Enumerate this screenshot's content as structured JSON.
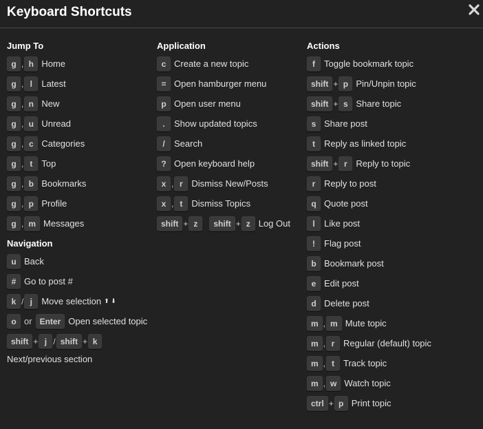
{
  "modal": {
    "title": "Keyboard Shortcuts",
    "close_icon": "close-x-icon"
  },
  "jump_to": {
    "title": "Jump To",
    "items": [
      {
        "keys": [
          "g",
          "h"
        ],
        "label": "Home"
      },
      {
        "keys": [
          "g",
          "l"
        ],
        "label": "Latest"
      },
      {
        "keys": [
          "g",
          "n"
        ],
        "label": "New"
      },
      {
        "keys": [
          "g",
          "u"
        ],
        "label": "Unread"
      },
      {
        "keys": [
          "g",
          "c"
        ],
        "label": "Categories"
      },
      {
        "keys": [
          "g",
          "t"
        ],
        "label": "Top"
      },
      {
        "keys": [
          "g",
          "b"
        ],
        "label": "Bookmarks"
      },
      {
        "keys": [
          "g",
          "p"
        ],
        "label": "Profile"
      },
      {
        "keys": [
          "g",
          "m"
        ],
        "label": "Messages"
      }
    ]
  },
  "navigation": {
    "title": "Navigation",
    "back": {
      "key": "u",
      "label": "Back"
    },
    "goto_post": {
      "key": "#",
      "label": "Go to post #"
    },
    "move_selection": {
      "key1": "k",
      "sep": "/",
      "key2": "j",
      "label": "Move selection",
      "arrows": "⬆ ⬇"
    },
    "open_selected": {
      "key1": "o",
      "or": "or",
      "key2": "Enter",
      "label": "Open selected topic"
    },
    "next_prev_section": {
      "k1": "shift",
      "plus1": "+",
      "k2": "j",
      "slash": "/",
      "k3": "shift",
      "plus2": "+",
      "k4": "k",
      "label": "Next/previous section"
    }
  },
  "application": {
    "title": "Application",
    "items": [
      {
        "keys": [
          "c"
        ],
        "label": "Create a new topic"
      },
      {
        "keys": [
          "="
        ],
        "label": "Open hamburger menu"
      },
      {
        "keys": [
          "p"
        ],
        "label": "Open user menu"
      },
      {
        "keys": [
          "."
        ],
        "label": "Show updated topics"
      },
      {
        "keys": [
          "/"
        ],
        "label": "Search"
      },
      {
        "keys": [
          "?"
        ],
        "label": "Open keyboard help"
      },
      {
        "keys": [
          "x",
          "r"
        ],
        "label": "Dismiss New/Posts"
      },
      {
        "keys": [
          "x",
          "t"
        ],
        "label": "Dismiss Topics"
      }
    ],
    "logout": {
      "k1": "shift",
      "plus1": "+",
      "k2": "z",
      "k3": "shift",
      "plus2": "+",
      "k4": "z",
      "label": "Log Out"
    }
  },
  "actions": {
    "title": "Actions",
    "items": [
      {
        "keys": [
          "f"
        ],
        "join": "",
        "label": "Toggle bookmark topic"
      },
      {
        "keys": [
          "shift",
          "p"
        ],
        "join": "+",
        "label": "Pin/Unpin topic"
      },
      {
        "keys": [
          "shift",
          "s"
        ],
        "join": "+",
        "label": "Share topic"
      },
      {
        "keys": [
          "s"
        ],
        "join": "",
        "label": "Share post"
      },
      {
        "keys": [
          "t"
        ],
        "join": "",
        "label": "Reply as linked topic"
      },
      {
        "keys": [
          "shift",
          "r"
        ],
        "join": "+",
        "label": "Reply to topic"
      },
      {
        "keys": [
          "r"
        ],
        "join": "",
        "label": "Reply to post"
      },
      {
        "keys": [
          "q"
        ],
        "join": "",
        "label": "Quote post"
      },
      {
        "keys": [
          "l"
        ],
        "join": "",
        "label": "Like post"
      },
      {
        "keys": [
          "!"
        ],
        "join": "",
        "label": "Flag post"
      },
      {
        "keys": [
          "b"
        ],
        "join": "",
        "label": "Bookmark post"
      },
      {
        "keys": [
          "e"
        ],
        "join": "",
        "label": "Edit post"
      },
      {
        "keys": [
          "d"
        ],
        "join": "",
        "label": "Delete post"
      },
      {
        "keys": [
          "m",
          "m"
        ],
        "join": ",",
        "label": "Mute topic"
      },
      {
        "keys": [
          "m",
          "r"
        ],
        "join": ",",
        "label": "Regular (default) topic"
      },
      {
        "keys": [
          "m",
          "t"
        ],
        "join": ",",
        "label": "Track topic"
      },
      {
        "keys": [
          "m",
          "w"
        ],
        "join": ",",
        "label": "Watch topic"
      },
      {
        "keys": [
          "ctrl",
          "p"
        ],
        "join": "+",
        "label": "Print topic"
      }
    ]
  },
  "colors": {
    "background": "#222222",
    "key_background": "#3a3a3a",
    "text": "#dddddd",
    "title": "#ffffff"
  }
}
